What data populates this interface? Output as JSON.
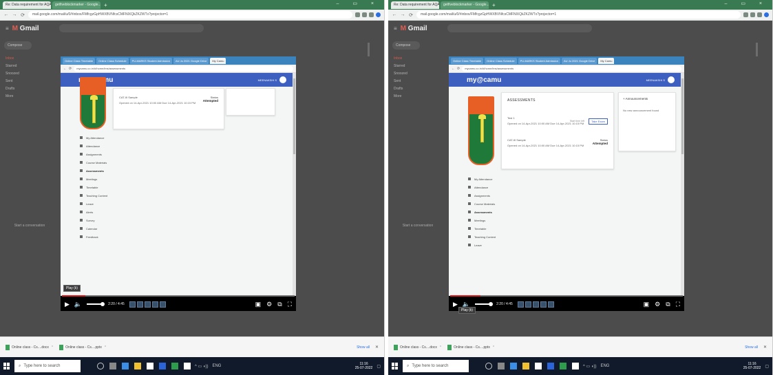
{
  "screens": [
    {
      "browser": {
        "tabs": [
          "Re: Data requirement for AQAR 2...",
          "getfiveblockmarker - Google..."
        ],
        "new_tab": "+",
        "url": "mail.google.com/mail/u/0/#inbox/FMfcgzGpHWXBVNfcsCMFNlXQkZKZWTx?projector=1",
        "window_controls": "– ▭ ×"
      },
      "gmail": {
        "logo_m": "M",
        "logo_text": "Gmail",
        "compose": "Compose",
        "hangouts": "Start a conversation",
        "nav": [
          "Inbox",
          "Starred",
          "Snoozed",
          "Sent",
          "Drafts",
          "More"
        ]
      },
      "inner_browser": {
        "tabs": [
          "Online Class Timetable",
          "Online Class Schedule",
          "PU-MARKS Student Admission",
          "AU Ju 2021 Google Drive",
          "My Camu"
        ],
        "url": "mycamu.co.in/#/home/lms/assessments"
      },
      "portal": {
        "logo": "my@camu",
        "user": "MEENAKSHI S",
        "menu": [
          "My Attendance",
          "Attendance",
          "Assignments",
          "Course Materials",
          "Assessments",
          "Meetings",
          "Timetable",
          "Teaching Content",
          "Leave",
          "Alerts",
          "Survey",
          "Calendar",
          "Feedback"
        ],
        "selected_menu": "Assessments"
      },
      "assessment": {
        "name": "CAT-III Sample",
        "date": "Opened on 14-Apr-2021 10:00 AM  Due 14-Apr-2021 10:15 PM",
        "status_label": "Status",
        "status_value": "Attempted"
      },
      "player": {
        "time": "2:20 / 4:45",
        "tooltip": "Play (k)",
        "progress": 0.1
      },
      "downloads": [
        {
          "name": "Online class - Cs....docx"
        },
        {
          "name": "Online class - Cs....pptx"
        }
      ],
      "downloads_show_all": "Show all",
      "taskbar": {
        "search_placeholder": "Type here to search",
        "time": "11:16",
        "date": "25-07-2022",
        "lang": "ENG"
      }
    },
    {
      "browser": {
        "tabs": [
          "Re: Data requirement for AQAR 2...",
          "getfiveblockmarker - Google..."
        ],
        "new_tab": "+",
        "url": "mail.google.com/mail/u/0/#inbox/FMfcgzGpHWXBVNfcsCMFNlXQkZKZWTx?projector=1",
        "window_controls": "– ▭ ×"
      },
      "gmail": {
        "logo_m": "M",
        "logo_text": "Gmail",
        "compose": "Compose",
        "hangouts": "Start a conversation",
        "nav": [
          "Inbox",
          "Starred",
          "Snoozed",
          "Sent",
          "Drafts",
          "More"
        ]
      },
      "inner_browser": {
        "tabs": [
          "Online Class Timetable",
          "Online Class Schedule",
          "PU-MARKS Student Admission",
          "AU Ju 2021 Google Drive",
          "My Camu"
        ],
        "url": "mycamu.co.in/#/home/lms/assessments"
      },
      "portal": {
        "logo": "my@camu",
        "user": "MEENAKSHI S",
        "menu": [
          "My Attendance",
          "Attendance",
          "Assignments",
          "Course Materials",
          "Assessments",
          "Meetings",
          "Timetable",
          "Teaching Content",
          "Leave"
        ],
        "selected_menu": "Assessments",
        "assessments_title": "ASSESSMENTS",
        "announcements_title": "Announcements",
        "announcements_empty": "No new announcement found"
      },
      "assessments": [
        {
          "name": "Test 1",
          "date": "Opened on 14-Apr-2021 10:00 AM  Due 14-Apr-2021 10:15 PM",
          "start_time": "Start time left",
          "action": "Take Exam"
        },
        {
          "name": "CAT-III Sample",
          "date": "Opened on 14-Apr-2021 10:00 AM  Due 14-Apr-2021 10:15 PM",
          "status_label": "Status",
          "status_value": "Attempted"
        }
      ],
      "player": {
        "time": "2:20 / 4:45",
        "tooltip": "Play (k)",
        "progress": 0.13
      },
      "downloads": [
        {
          "name": "Online class - Cs....docx"
        },
        {
          "name": "Online class - Cs....pptx"
        }
      ],
      "downloads_show_all": "Show all",
      "taskbar": {
        "search_placeholder": "Type here to search",
        "time": "11:16",
        "date": "25-07-2022",
        "lang": "ENG"
      }
    }
  ]
}
